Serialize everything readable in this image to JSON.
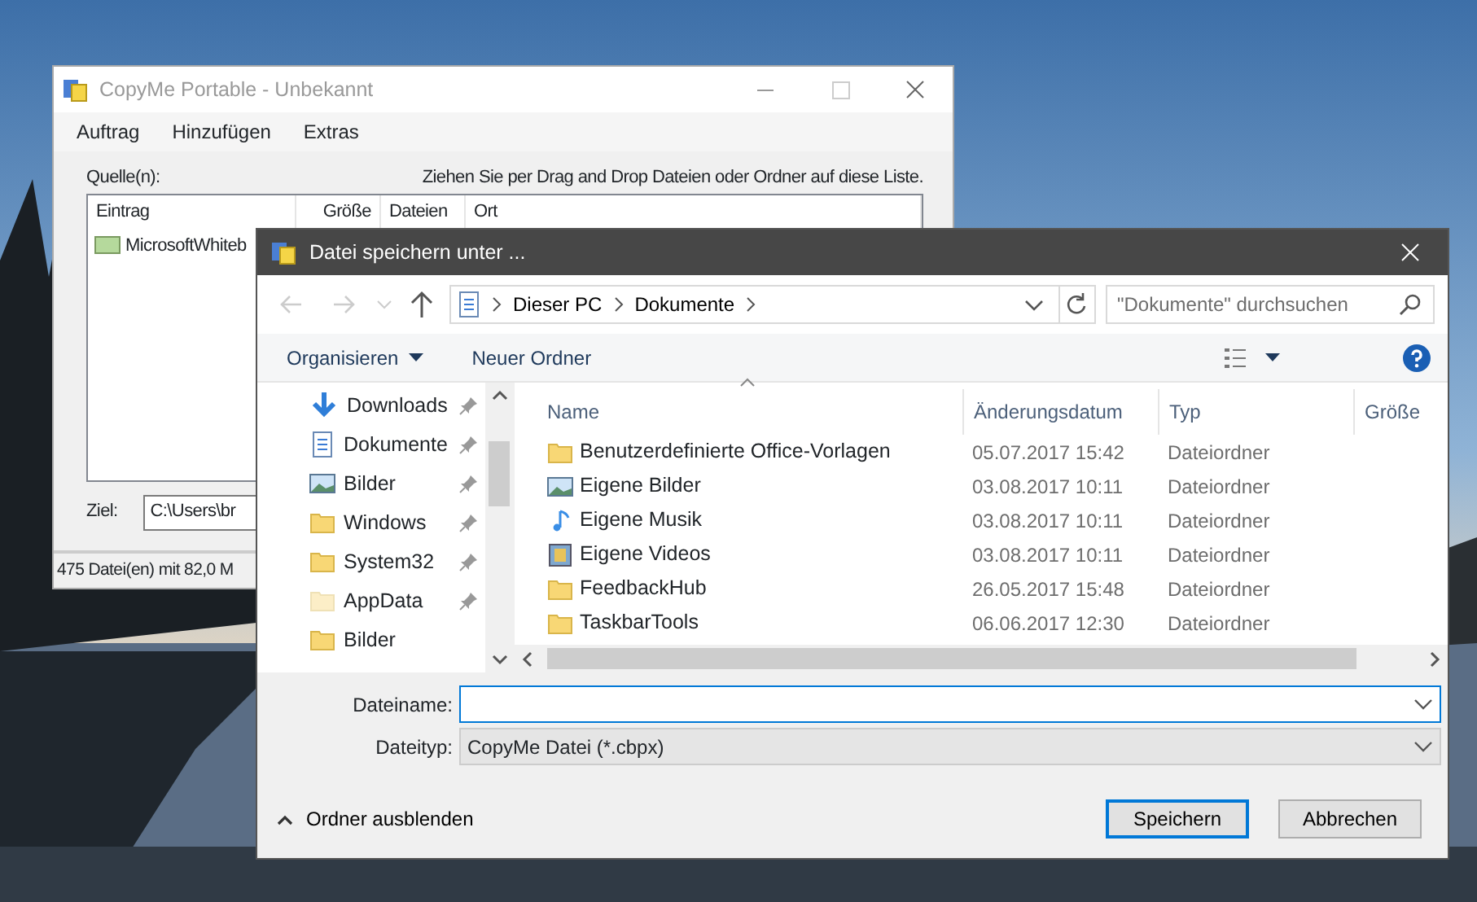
{
  "back_window": {
    "title": "CopyMe Portable - Unbekannt",
    "active": false,
    "menu": [
      "Auftrag",
      "Hinzufügen",
      "Extras"
    ],
    "sources_label": "Quelle(n):",
    "hint": "Ziehen Sie per Drag and Drop Dateien oder Ordner auf diese Liste.",
    "columns": [
      "Eintrag",
      "Größe",
      "Dateien",
      "Ort"
    ],
    "rows": [
      {
        "entry": "MicrosoftWhiteb"
      }
    ],
    "target_label": "Ziel:",
    "target_value": "C:\\Users\\br",
    "status": "475 Datei(en) mit 82,0 M"
  },
  "dialog": {
    "title": "Datei speichern unter ...",
    "breadcrumb": [
      "Dieser PC",
      "Dokumente"
    ],
    "search": {
      "placeholder": "\"Dokumente\" durchsuchen"
    },
    "toolbar": [
      "Organisieren",
      "Neuer Ordner"
    ],
    "nav_items": [
      {
        "kind": "download",
        "label": "Downloads",
        "pinned": true,
        "hidden": false
      },
      {
        "kind": "documents",
        "label": "Dokumente",
        "pinned": true,
        "hidden": false
      },
      {
        "kind": "pictures",
        "label": "Bilder",
        "pinned": true,
        "hidden": false
      },
      {
        "kind": "folder",
        "label": "Windows",
        "pinned": true,
        "hidden": false
      },
      {
        "kind": "folder",
        "label": "System32",
        "pinned": true,
        "hidden": false
      },
      {
        "kind": "folder",
        "label": "AppData",
        "pinned": true,
        "hidden": true
      },
      {
        "kind": "folder",
        "label": "Bilder",
        "pinned": false,
        "hidden": false
      }
    ],
    "columns": [
      "Name",
      "Änderungsdatum",
      "Typ",
      "Größe"
    ],
    "files": [
      {
        "kind": "folder",
        "name": "Benutzerdefinierte Office-Vorlagen",
        "date": "05.07.2017 15:42",
        "type": "Dateiordner"
      },
      {
        "kind": "pictures",
        "name": "Eigene Bilder",
        "date": "03.08.2017 10:11",
        "type": "Dateiordner"
      },
      {
        "kind": "music",
        "name": "Eigene Musik",
        "date": "03.08.2017 10:11",
        "type": "Dateiordner"
      },
      {
        "kind": "videos",
        "name": "Eigene Videos",
        "date": "03.08.2017 10:11",
        "type": "Dateiordner"
      },
      {
        "kind": "folder",
        "name": "FeedbackHub",
        "date": "26.05.2017 15:48",
        "type": "Dateiordner"
      },
      {
        "kind": "folder",
        "name": "TaskbarTools",
        "date": "06.06.2017 12:30",
        "type": "Dateiordner"
      }
    ],
    "filename_label": "Dateiname:",
    "filetype_label": "Dateityp:",
    "filetype_value": "CopyMe Datei (*.cbpx)",
    "hide_folders": "Ordner ausblenden",
    "buttons": [
      {
        "label": "Speichern",
        "default": true
      },
      {
        "label": "Abbrechen",
        "default": false
      }
    ]
  }
}
